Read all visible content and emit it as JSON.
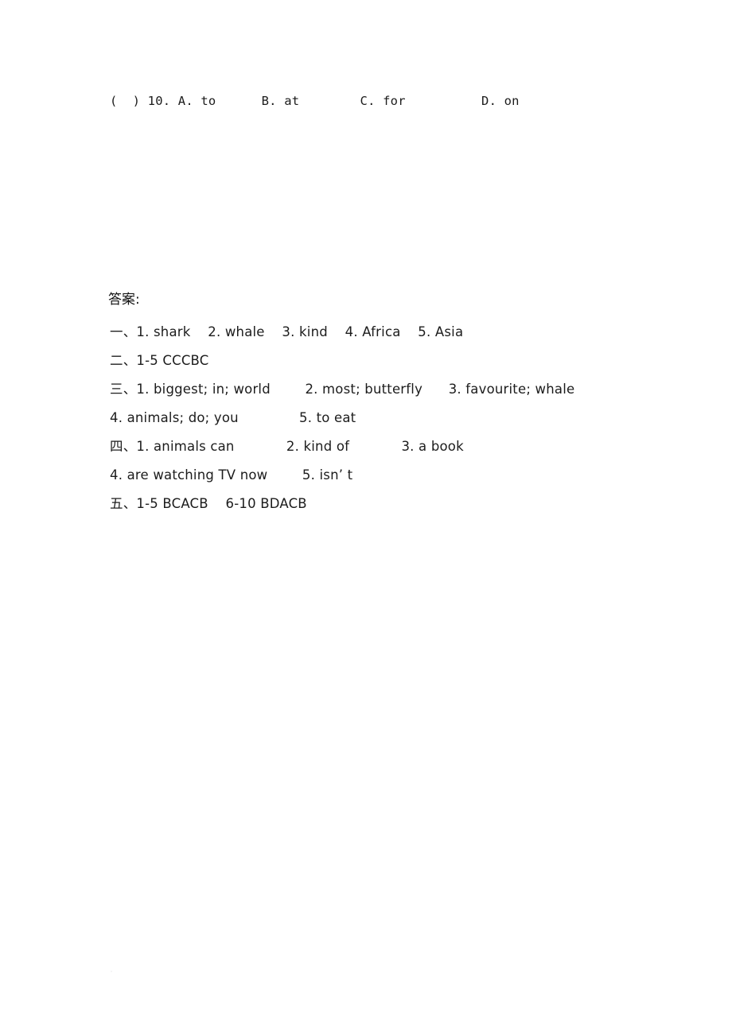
{
  "document": {
    "background_color": "#ffffff",
    "text_color": "#1c1c1c",
    "question_line": "(  ) 10. A. to      B. at        C. for          D. on",
    "answers_heading": "答案:",
    "answer_lines": [
      "一、1. shark    2. whale    3. kind    4. Africa    5. Asia",
      "二、1-5 CCCBC",
      "三、1. biggest; in; world        2. most; butterfly      3. favourite; whale",
      "4. animals; do; you              5. to eat",
      "四、1. animals can            2. kind of            3. a book",
      "4. are watching TV now        5. isn’ t",
      "五、1-5 BCACB    6-10 BDACB"
    ]
  }
}
